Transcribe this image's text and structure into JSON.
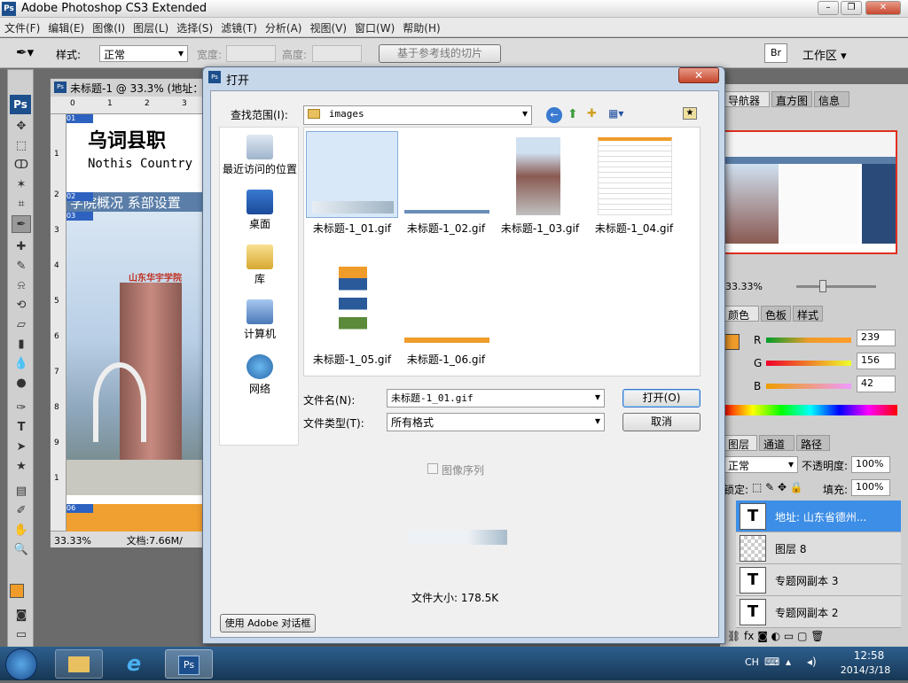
{
  "app": {
    "title": "Adobe Photoshop CS3 Extended",
    "logo": "Ps"
  },
  "window_controls": {
    "minimize": "–",
    "restore": "❐",
    "close": "✕"
  },
  "menu": [
    "文件(F)",
    "编辑(E)",
    "图像(I)",
    "图层(L)",
    "选择(S)",
    "滤镜(T)",
    "分析(A)",
    "视图(V)",
    "窗口(W)",
    "帮助(H)"
  ],
  "options": {
    "style_label": "样式:",
    "style_value": "正常",
    "width_label": "宽度:",
    "height_label": "高度:",
    "slices_button": "基于参考线的切片",
    "workspace_label": "工作区 ▾"
  },
  "document": {
    "tab_title": "未标题-1 @ 33.3% (地址：",
    "zoom": "33.33%",
    "file_size": "文档:7.66M/",
    "banner_title": "乌词县职",
    "banner_sub": "Nothis Country",
    "nav_text": "学院概况  系部设置",
    "slice_labels": [
      "01",
      "02",
      "03",
      "06"
    ],
    "building_sign": "山东华宇学院"
  },
  "ruler": {
    "marks": [
      "0",
      "1",
      "2",
      "3"
    ],
    "vmarks": [
      "1",
      "2",
      "3",
      "4",
      "5",
      "6",
      "7",
      "8",
      "9",
      "1"
    ]
  },
  "panels": {
    "nav_tabs": [
      "导航器",
      "直方图",
      "信息"
    ],
    "nav_zoom": "33.33%",
    "color_tabs": [
      "颜色",
      "色板",
      "样式"
    ],
    "color": {
      "r_label": "R",
      "g_label": "G",
      "b_label": "B",
      "r": "239",
      "g": "156",
      "b": "42",
      "swatch": "#ef9c2a"
    },
    "layers_tabs": [
      "图层",
      "通道",
      "路径"
    ],
    "blend_mode": "正常",
    "opacity_label": "不透明度:",
    "opacity": "100%",
    "lock_label": "锁定:",
    "fill_label": "填充:",
    "fill": "100%",
    "layers": [
      {
        "name": "地址: 山东省德州...",
        "type": "T"
      },
      {
        "name": "图层 8",
        "type": ""
      },
      {
        "name": "专题网副本 3",
        "type": "T"
      },
      {
        "name": "专题网副本 2",
        "type": "T"
      }
    ]
  },
  "dialog": {
    "title": "打开",
    "look_in_label": "查找范围(I):",
    "look_in_value": "images",
    "places": [
      "最近访问的位置",
      "桌面",
      "库",
      "计算机",
      "网络"
    ],
    "files": [
      "未标题-1_01.gif",
      "未标题-1_02.gif",
      "未标题-1_03.gif",
      "未标题-1_04.gif",
      "未标题-1_05.gif",
      "未标题-1_06.gif"
    ],
    "filename_label": "文件名(N):",
    "filename_value": "未标题-1_01.gif",
    "filetype_label": "文件类型(T):",
    "filetype_value": "所有格式",
    "open_button": "打开(O)",
    "cancel_button": "取消",
    "image_sequence": "图像序列",
    "file_size": "文件大小: 178.5K",
    "adobe_dialog_button": "使用 Adobe 对话框"
  },
  "taskbar": {
    "time": "12:58",
    "date": "2014/3/18",
    "lang": "CH",
    "ps_label": "Ps"
  },
  "colors": {
    "orange": "#ef9c2a",
    "dialog_frame": "#c7d7ea",
    "selection": "#3d8ee6"
  }
}
